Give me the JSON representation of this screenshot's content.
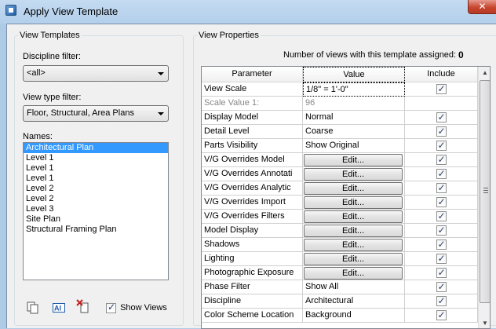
{
  "window": {
    "title": "Apply View Template",
    "close_glyph": "✕"
  },
  "left": {
    "group_label": "View Templates",
    "discipline_label": "Discipline filter:",
    "discipline_value": "<all>",
    "viewtype_label": "View type filter:",
    "viewtype_value": "Floor, Structural, Area Plans",
    "names_label": "Names:",
    "names": [
      "Architectural Plan",
      "Level 1",
      "Level 1",
      "Level 1",
      "Level 2",
      "Level 2",
      "Level 3",
      "Site Plan",
      "Structural Framing Plan"
    ],
    "selected_index": 0,
    "show_views_label": "Show Views",
    "show_views_checked": true
  },
  "right": {
    "group_label": "View Properties",
    "count_label": "Number of views with this template assigned:",
    "count_value": "0",
    "columns": {
      "param": "Parameter",
      "value": "Value",
      "include": "Include"
    },
    "rows": [
      {
        "param": "View Scale",
        "value": "1/8\" = 1'-0\"",
        "type": "text",
        "include": true,
        "focused": true
      },
      {
        "param": "Scale Value    1:",
        "value": "96",
        "type": "text",
        "include": null,
        "disabled": true
      },
      {
        "param": "Display Model",
        "value": "Normal",
        "type": "text",
        "include": true
      },
      {
        "param": "Detail Level",
        "value": "Coarse",
        "type": "text",
        "include": true
      },
      {
        "param": "Parts Visibility",
        "value": "Show Original",
        "type": "text",
        "include": true
      },
      {
        "param": "V/G Overrides Model",
        "value": "Edit...",
        "type": "button",
        "include": true
      },
      {
        "param": "V/G Overrides Annotati",
        "value": "Edit...",
        "type": "button",
        "include": true
      },
      {
        "param": "V/G Overrides Analytic",
        "value": "Edit...",
        "type": "button",
        "include": true
      },
      {
        "param": "V/G Overrides Import",
        "value": "Edit...",
        "type": "button",
        "include": true
      },
      {
        "param": "V/G Overrides Filters",
        "value": "Edit...",
        "type": "button",
        "include": true
      },
      {
        "param": "Model Display",
        "value": "Edit...",
        "type": "button",
        "include": true
      },
      {
        "param": "Shadows",
        "value": "Edit...",
        "type": "button",
        "include": true
      },
      {
        "param": "Lighting",
        "value": "Edit...",
        "type": "button",
        "include": true
      },
      {
        "param": "Photographic Exposure",
        "value": "Edit...",
        "type": "button",
        "include": true
      },
      {
        "param": "Phase Filter",
        "value": "Show All",
        "type": "text",
        "include": true
      },
      {
        "param": "Discipline",
        "value": "Architectural",
        "type": "text",
        "include": true
      },
      {
        "param": "Color Scheme Location",
        "value": "Background",
        "type": "text",
        "include": true
      }
    ]
  },
  "icons": [
    "duplicate-icon",
    "rename-icon",
    "delete-icon",
    "close-icon",
    "scroll-up-icon",
    "scroll-down-icon"
  ]
}
